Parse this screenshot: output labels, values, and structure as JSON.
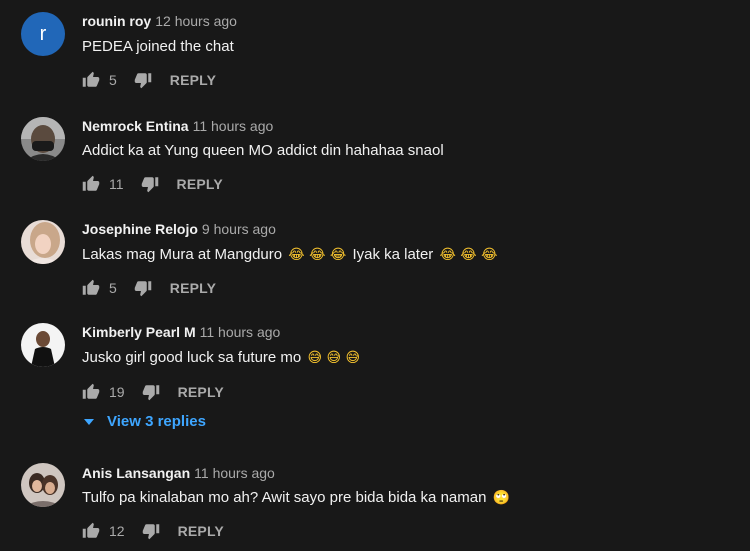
{
  "colors": {
    "background": "#181818",
    "link": "#3ea6ff",
    "avatar_letter_bg": "#2167b8"
  },
  "comments": [
    {
      "avatar_letter": "r",
      "author": "rounin roy",
      "time": "12 hours ago",
      "text": "PEDEA joined the chat",
      "likes": "5",
      "reply_label": "REPLY"
    },
    {
      "author": "Nemrock Entina",
      "time": "11 hours ago",
      "text": "Addict ka at Yung queen MO addict din hahahaa snaol",
      "likes": "11",
      "reply_label": "REPLY"
    },
    {
      "author": "Josephine Relojo",
      "time": "9 hours ago",
      "text_a": "Lakas mag Mura at Mangduro",
      "emoji_a": "😂 😂 😂",
      "text_b": "Iyak ka later",
      "emoji_b": "😂 😂 😂",
      "likes": "5",
      "reply_label": "REPLY"
    },
    {
      "author": "Kimberly Pearl M",
      "time": "11 hours ago",
      "text": "Jusko girl good luck sa future mo",
      "emoji": "😅 😅 😅",
      "likes": "19",
      "reply_label": "REPLY",
      "view_replies": "View 3 replies"
    },
    {
      "author": "Anis Lansangan",
      "time": "11 hours ago",
      "text": "Tulfo pa kinalaban mo ah? Awit sayo pre bida bida ka naman",
      "emoji": "🙄",
      "likes": "12",
      "reply_label": "REPLY"
    }
  ]
}
